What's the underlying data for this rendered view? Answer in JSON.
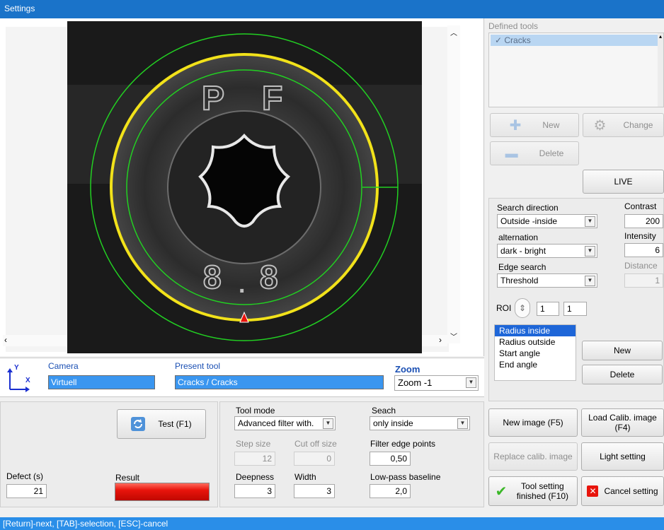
{
  "window": {
    "title": "Settings"
  },
  "tools": {
    "header": "Defined tools",
    "items": [
      {
        "label": "✓ Cracks",
        "selected": true
      }
    ],
    "new_label": "New",
    "change_label": "Change",
    "delete_label": "Delete",
    "live_label": "LIVE"
  },
  "params": {
    "search_direction_label": "Search direction",
    "search_direction_value": "Outside -inside",
    "alternation_label": "alternation",
    "alternation_value": "dark - bright",
    "edge_search_label": "Edge search",
    "edge_search_value": "Threshold",
    "contrast_label": "Contrast",
    "contrast_value": "200",
    "intensity_label": "Intensity",
    "intensity_value": "6",
    "distance_label": "Distance",
    "distance_value": "1",
    "roi_label": "ROI",
    "roi_value1": "1",
    "roi_value2": "1",
    "roi_items": [
      "Radius inside",
      "Radius outside",
      "Start angle",
      "End angle"
    ],
    "roi_new_label": "New",
    "roi_delete_label": "Delete"
  },
  "info": {
    "axis_y": "Y",
    "axis_x": "X",
    "camera_label": "Camera",
    "camera_value": "Virtuell",
    "present_tool_label": "Present tool",
    "present_tool_value": "Cracks / Cracks",
    "zoom_label": "Zoom",
    "zoom_value": "Zoom -1"
  },
  "bottom": {
    "test_label": "Test (F1)",
    "defect_label": "Defect (s)",
    "defect_value": "21",
    "result_label": "Result",
    "result_color": "#e8140c",
    "tool_mode_label": "Tool mode",
    "tool_mode_value": "Advanced filter with.",
    "seach_label": "Seach",
    "seach_value": "only inside",
    "step_size_label": "Step size",
    "step_size_value": "12",
    "cut_off_label": "Cut off size",
    "cut_off_value": "0",
    "filter_edge_label": "Filter edge points",
    "filter_edge_value": "0,50",
    "deepness_label": "Deepness",
    "deepness_value": "3",
    "width_label": "Width",
    "width_value": "3",
    "lowpass_label": "Low-pass baseline",
    "lowpass_value": "2,0"
  },
  "actions": {
    "new_image_label": "New image (F5)",
    "load_calib_label": "Load Calib. image (F4)",
    "replace_calib_label": "Replace calib. image",
    "light_setting_label": "Light setting",
    "tool_finished_label": "Tool setting finished (F10)",
    "cancel_setting_label": "Cancel setting"
  },
  "image": {
    "embossed_letters": [
      "P",
      "F"
    ],
    "embossed_digits": [
      "8",
      ".",
      "8"
    ]
  },
  "status": {
    "text": "[Return]-next, [TAB]-selection, [ESC]-cancel"
  },
  "colors": {
    "titlebar": "#1a73c9",
    "statusbar": "#2a8ee8",
    "selection": "#3a96f0",
    "overlay_green": "#22d022",
    "overlay_yellow": "#f2e21a",
    "overlay_red": "#e8140c"
  }
}
